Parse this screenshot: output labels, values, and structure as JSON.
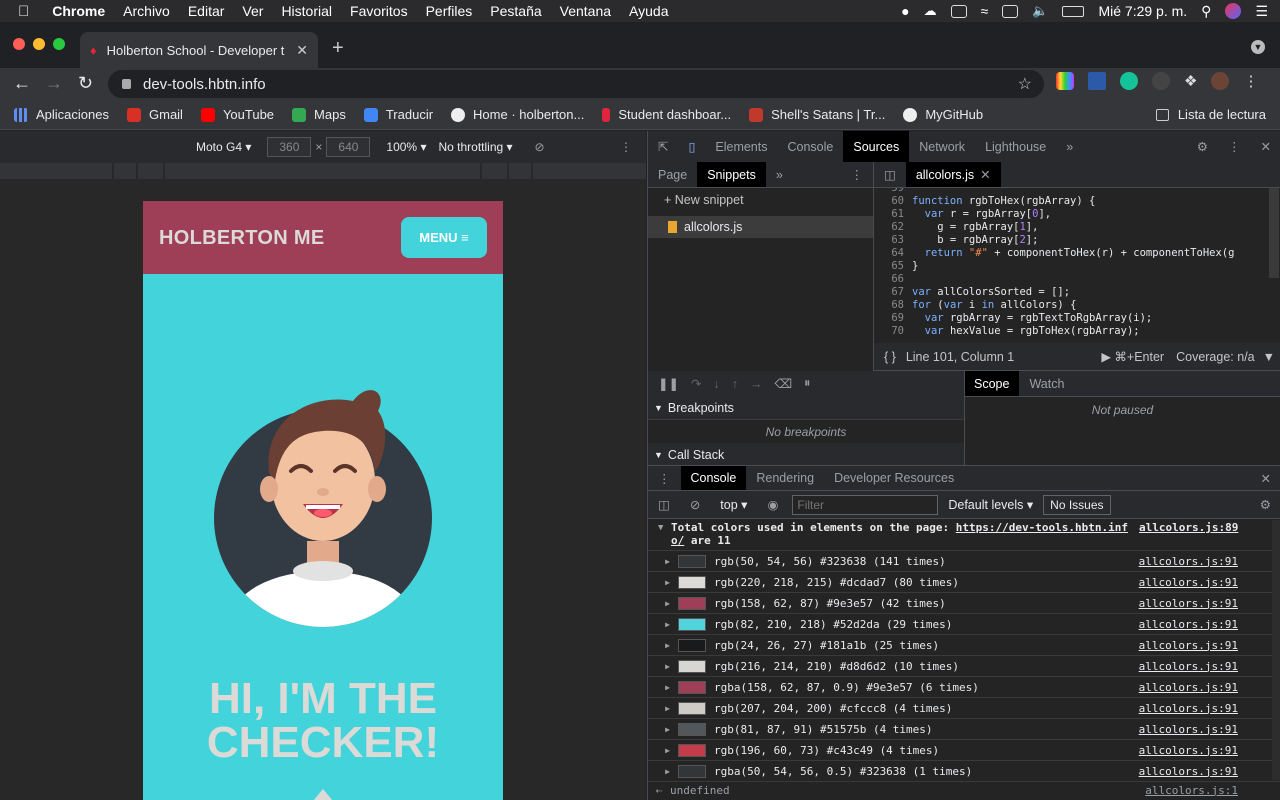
{
  "menubar": {
    "app": "Chrome",
    "items": [
      "Archivo",
      "Editar",
      "Ver",
      "Historial",
      "Favoritos",
      "Perfiles",
      "Pestaña",
      "Ventana",
      "Ayuda"
    ],
    "clock": "Mié 7:29 p. m."
  },
  "tab": {
    "title": "Holberton School - Developer t"
  },
  "omnibox": {
    "url": "dev-tools.hbtn.info"
  },
  "bookmarks": [
    {
      "label": "Aplicaciones",
      "color": "#5f8ef0"
    },
    {
      "label": "Gmail",
      "color": "#d93025"
    },
    {
      "label": "YouTube",
      "color": "#ff0000"
    },
    {
      "label": "Maps",
      "color": "#34a853"
    },
    {
      "label": "Traducir",
      "color": "#4285f4"
    },
    {
      "label": "Home · holberton...",
      "color": "#eeeeee"
    },
    {
      "label": "Student dashboar...",
      "color": "#e0263e"
    },
    {
      "label": "Shell's Satans | Tr...",
      "color": "#c0392b"
    },
    {
      "label": "MyGitHub",
      "color": "#eeeeee"
    }
  ],
  "reading_list": "Lista de lectura",
  "device_toolbar": {
    "device": "Moto G4",
    "width": "360",
    "height": "640",
    "zoom": "100%",
    "throttle": "No throttling"
  },
  "page": {
    "brand": "HOLBERTON ME",
    "menu_label": "MENU ≡",
    "hero_line1": "HI, I'M THE",
    "hero_line2": "CHECKER!"
  },
  "devtools": {
    "tabs": [
      "Elements",
      "Console",
      "Sources",
      "Network",
      "Lighthouse"
    ],
    "active_tab": "Sources",
    "nav_tabs": [
      "Page",
      "Snippets"
    ],
    "new_snippet": "+ New snippet",
    "snippet_file": "allcolors.js",
    "editor_tab": "allcolors.js",
    "code_lines": [
      {
        "n": "59",
        "t": ""
      },
      {
        "n": "60",
        "t": "function rgbToHex(rgbArray) {"
      },
      {
        "n": "61",
        "t": "  var r = rgbArray[0],"
      },
      {
        "n": "62",
        "t": "    g = rgbArray[1],"
      },
      {
        "n": "63",
        "t": "    b = rgbArray[2];"
      },
      {
        "n": "64",
        "t": "  return \"#\" + componentToHex(r) + componentToHex(g"
      },
      {
        "n": "65",
        "t": "}"
      },
      {
        "n": "66",
        "t": ""
      },
      {
        "n": "67",
        "t": "var allColorsSorted = [];"
      },
      {
        "n": "68",
        "t": "for (var i in allColors) {"
      },
      {
        "n": "69",
        "t": "  var rgbArray = rgbTextToRgbArray(i);"
      },
      {
        "n": "70",
        "t": "  var hexValue = rgbToHex(rgbArray);"
      }
    ],
    "status_position": "Line 101, Column 1",
    "run_hint": "⌘+Enter",
    "coverage": "Coverage: n/a",
    "scope_tabs": [
      "Scope",
      "Watch"
    ],
    "not_paused": "Not paused",
    "breakpoints_title": "Breakpoints",
    "no_breakpoints": "No breakpoints",
    "callstack_title": "Call Stack",
    "drawer_tabs": [
      "Console",
      "Rendering",
      "Developer Resources"
    ],
    "context": "top",
    "filter_placeholder": "Filter",
    "levels": "Default levels",
    "issues": "No Issues"
  },
  "console": {
    "header_text_a": "Total colors used in elements on the page: ",
    "header_link": "https://dev-tools.hbtn.inf",
    "header_link2": "o/",
    "header_text_b": " are 11",
    "header_src": "allcolors.js:89",
    "rows": [
      {
        "text": "rgb(50, 54, 56) #323638 (141 times)",
        "color": "#323638",
        "src": "allcolors.js:91"
      },
      {
        "text": "rgb(220, 218, 215) #dcdad7 (80 times)",
        "color": "#dcdad7",
        "src": "allcolors.js:91"
      },
      {
        "text": "rgb(158, 62, 87) #9e3e57 (42 times)",
        "color": "#9e3e57",
        "src": "allcolors.js:91"
      },
      {
        "text": "rgb(82, 210, 218) #52d2da (29 times)",
        "color": "#52d2da",
        "src": "allcolors.js:91"
      },
      {
        "text": "rgb(24, 26, 27) #181a1b (25 times)",
        "color": "#181a1b",
        "src": "allcolors.js:91"
      },
      {
        "text": "rgb(216, 214, 210) #d8d6d2 (10 times)",
        "color": "#d8d6d2",
        "src": "allcolors.js:91"
      },
      {
        "text": "rgba(158, 62, 87, 0.9) #9e3e57 (6 times)",
        "color": "#9e3e57",
        "src": "allcolors.js:91"
      },
      {
        "text": "rgb(207, 204, 200) #cfccc8 (4 times)",
        "color": "#cfccc8",
        "src": "allcolors.js:91"
      },
      {
        "text": "rgb(81, 87, 91) #51575b (4 times)",
        "color": "#51575b",
        "src": "allcolors.js:91"
      },
      {
        "text": "rgb(196, 60, 73) #c43c49 (4 times)",
        "color": "#c43c49",
        "src": "allcolors.js:91"
      },
      {
        "text": "rgba(50, 54, 56, 0.5) #323638 (1 times)",
        "color": "#323638",
        "src": "allcolors.js:91"
      }
    ],
    "result": "undefined",
    "result_src": "allcolors.js:1"
  }
}
